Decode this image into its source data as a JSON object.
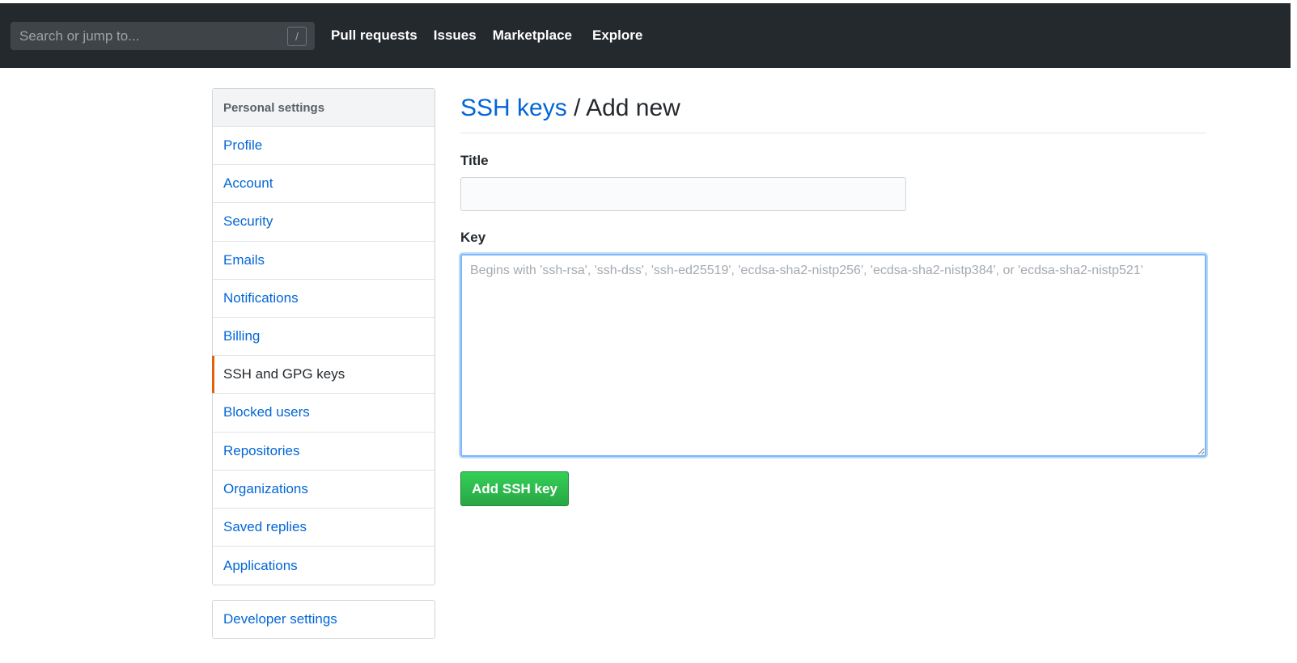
{
  "topbar": {
    "search_placeholder": "Search or jump to...",
    "search_shortcut": "/",
    "nav": [
      "Pull requests",
      "Issues",
      "Marketplace",
      "Explore"
    ]
  },
  "sidebar": {
    "header": "Personal settings",
    "items": [
      {
        "label": "Profile"
      },
      {
        "label": "Account"
      },
      {
        "label": "Security"
      },
      {
        "label": "Emails"
      },
      {
        "label": "Notifications"
      },
      {
        "label": "Billing"
      },
      {
        "label": "SSH and GPG keys"
      },
      {
        "label": "Blocked users"
      },
      {
        "label": "Repositories"
      },
      {
        "label": "Organizations"
      },
      {
        "label": "Saved replies"
      },
      {
        "label": "Applications"
      }
    ],
    "selected": "SSH and GPG keys",
    "developer_settings": "Developer settings"
  },
  "main": {
    "breadcrumb": "SSH keys",
    "separator": "/",
    "title": "Add new",
    "title_label": "Title",
    "title_value": "",
    "key_label": "Key",
    "key_value": "",
    "key_placeholder": "Begins with 'ssh-rsa', 'ssh-dss', 'ssh-ed25519', 'ecdsa-sha2-nistp256', 'ecdsa-sha2-nistp384', or 'ecdsa-sha2-nistp521'",
    "submit_label": "Add SSH key"
  },
  "colors": {
    "topbar_bg": "#24292e",
    "link": "#0366d6",
    "selected_accent": "#e36209",
    "button_green": "#28a745",
    "focus_border": "#79b8ff"
  }
}
